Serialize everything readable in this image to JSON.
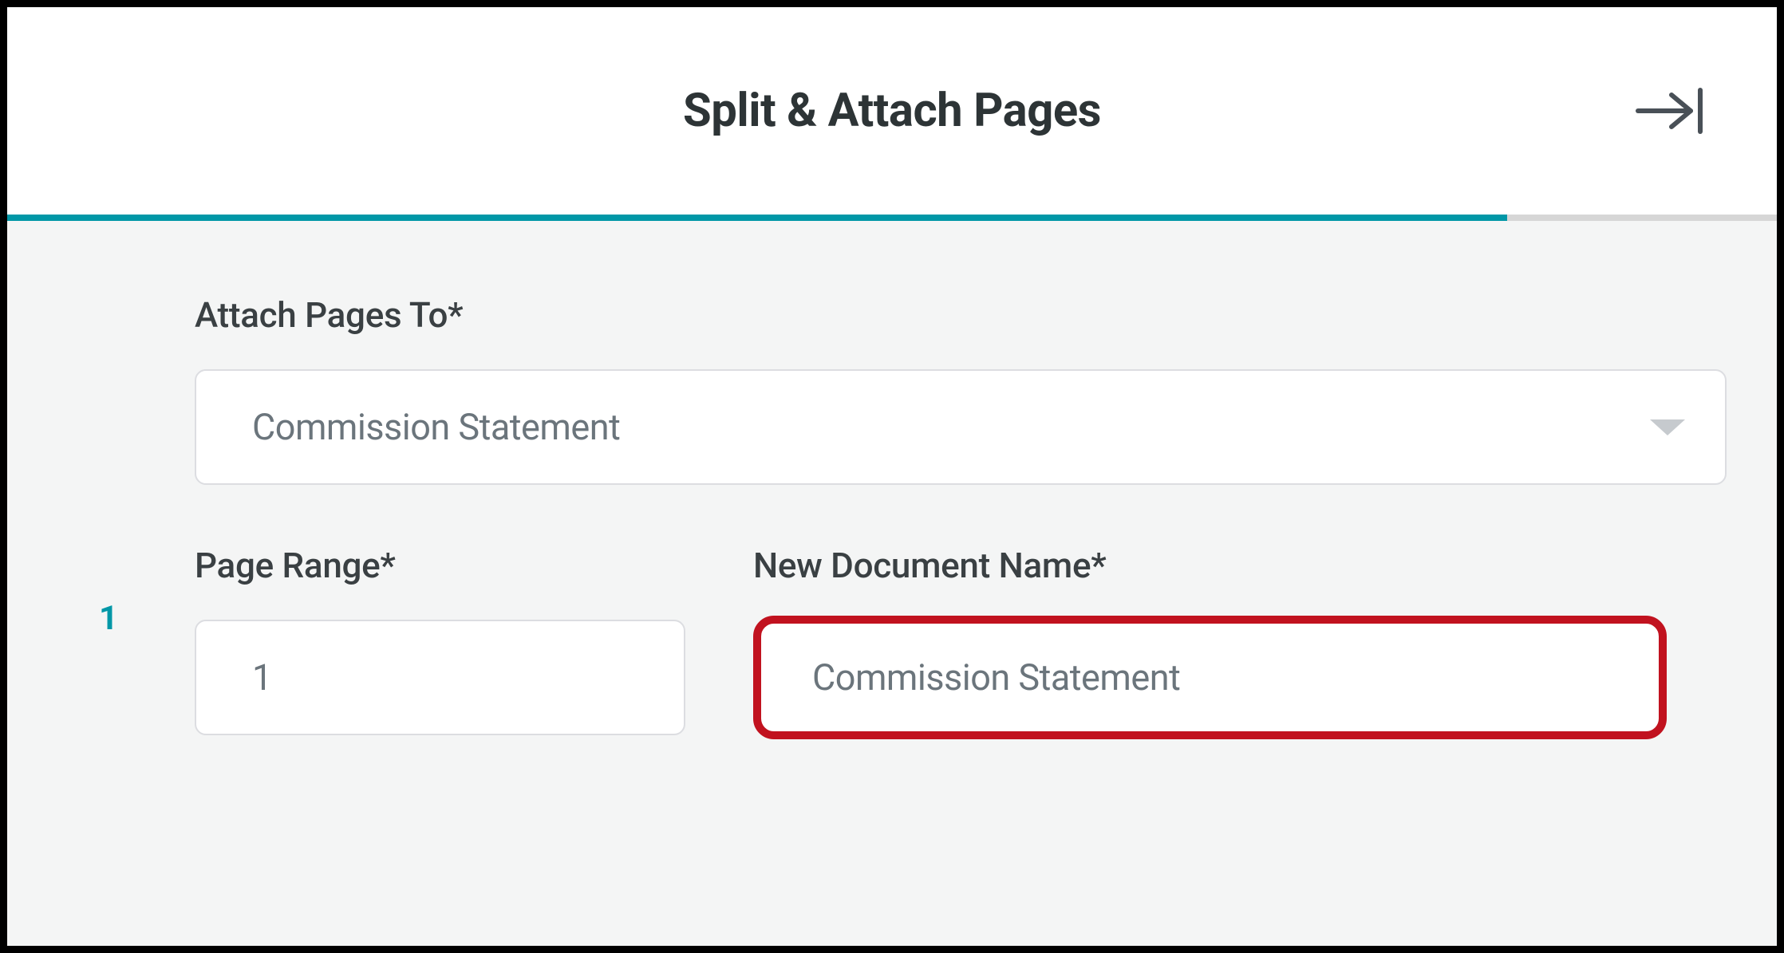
{
  "header": {
    "title": "Split & Attach Pages"
  },
  "form": {
    "attach_to": {
      "label": "Attach Pages To*",
      "selected": "Commission Statement"
    },
    "row_number": "1",
    "page_range": {
      "label": "Page Range*",
      "value": "1"
    },
    "new_document_name": {
      "label": "New Document Name*",
      "value": "Commission Statement"
    }
  }
}
